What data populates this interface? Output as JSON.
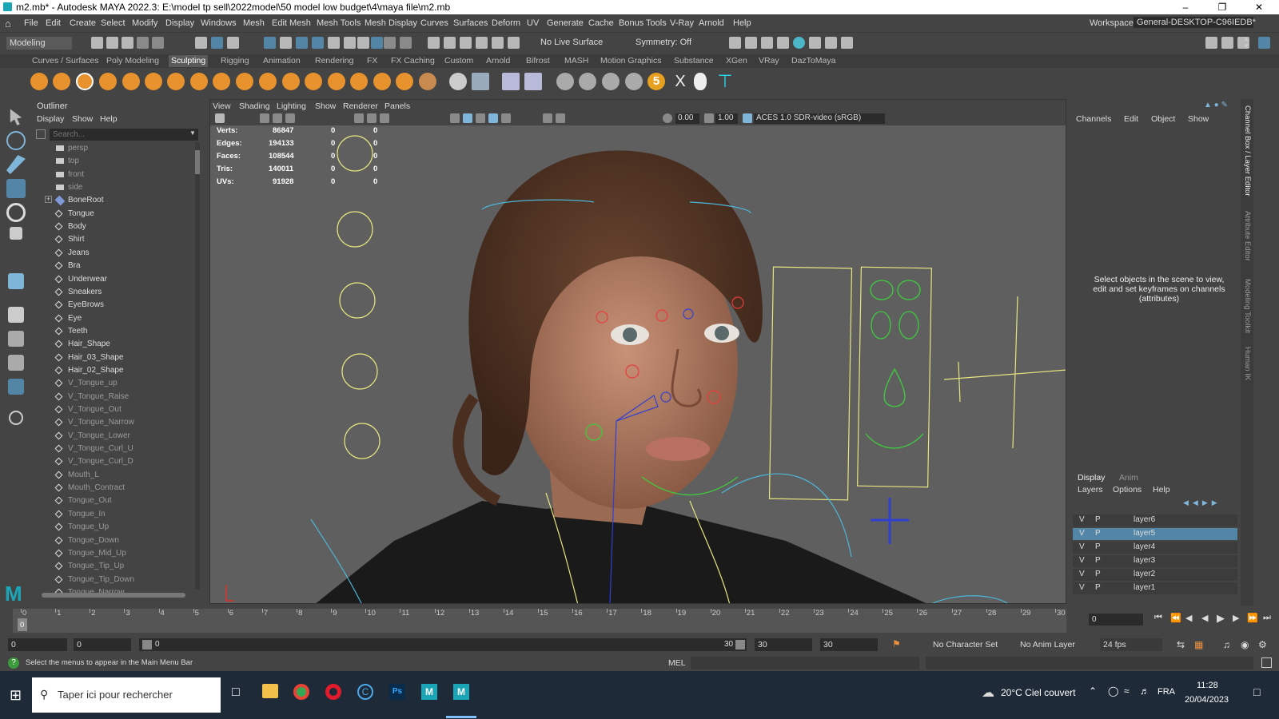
{
  "window": {
    "title": "m2.mb* - Autodesk MAYA 2022.3: E:\\model tp sell\\2022model\\50 model low budget\\4\\maya file\\m2.mb"
  },
  "menubar": {
    "items": [
      "File",
      "Edit",
      "Create",
      "Select",
      "Modify",
      "Display",
      "Windows",
      "Mesh",
      "Edit Mesh",
      "Mesh Tools",
      "Mesh Display",
      "Curves",
      "Surfaces",
      "Deform",
      "UV",
      "Generate",
      "Cache",
      "Bonus Tools",
      "V-Ray",
      "Arnold",
      "Help"
    ],
    "workspace_label": "Workspace:",
    "workspace_value": "General-DESKTOP-C96IEDB*"
  },
  "statusline": {
    "mode": "Modeling",
    "live_surface": "No Live Surface",
    "symmetry": "Symmetry: Off"
  },
  "shelf": {
    "tabs": [
      "Curves / Surfaces",
      "Poly Modeling",
      "Sculpting",
      "Rigging",
      "Animation",
      "Rendering",
      "FX",
      "FX Caching",
      "Custom",
      "Arnold",
      "Bifrost",
      "MASH",
      "Motion Graphics",
      "Substance",
      "XGen",
      "VRay",
      "DazToMaya"
    ],
    "active": "Sculpting",
    "badge": "5"
  },
  "outliner": {
    "title": "Outliner",
    "menus": [
      "Display",
      "Show",
      "Help"
    ],
    "search_placeholder": "Search...",
    "items": [
      {
        "label": "persp",
        "dim": true
      },
      {
        "label": "top",
        "dim": true
      },
      {
        "label": "front",
        "dim": true
      },
      {
        "label": "side",
        "dim": true
      },
      {
        "label": "BoneRoot"
      },
      {
        "label": "Tongue"
      },
      {
        "label": "Body"
      },
      {
        "label": "Shirt"
      },
      {
        "label": "Jeans"
      },
      {
        "label": "Bra"
      },
      {
        "label": "Underwear"
      },
      {
        "label": "Sneakers"
      },
      {
        "label": "EyeBrows"
      },
      {
        "label": "Eye"
      },
      {
        "label": "Teeth"
      },
      {
        "label": "Hair_Shape"
      },
      {
        "label": "Hair_03_Shape"
      },
      {
        "label": "Hair_02_Shape"
      },
      {
        "label": "V_Tongue_up",
        "dim": true
      },
      {
        "label": "V_Tongue_Raise",
        "dim": true
      },
      {
        "label": "V_Tongue_Out",
        "dim": true
      },
      {
        "label": "V_Tongue_Narrow",
        "dim": true
      },
      {
        "label": "V_Tongue_Lower",
        "dim": true
      },
      {
        "label": "V_Tongue_Curl_U",
        "dim": true
      },
      {
        "label": "V_Tongue_Curl_D",
        "dim": true
      },
      {
        "label": "Mouth_L",
        "dim": true
      },
      {
        "label": "Mouth_Contract",
        "dim": true
      },
      {
        "label": "Tongue_Out",
        "dim": true
      },
      {
        "label": "Tongue_In",
        "dim": true
      },
      {
        "label": "Tongue_Up",
        "dim": true
      },
      {
        "label": "Tongue_Down",
        "dim": true
      },
      {
        "label": "Tongue_Mid_Up",
        "dim": true
      },
      {
        "label": "Tongue_Tip_Up",
        "dim": true
      },
      {
        "label": "Tongue_Tip_Down",
        "dim": true
      },
      {
        "label": "Tongue_Narrow",
        "dim": true
      }
    ]
  },
  "viewport": {
    "menus": [
      "View",
      "Shading",
      "Lighting",
      "Show",
      "Renderer",
      "Panels"
    ],
    "exposure": "0.00",
    "gamma": "1.00",
    "colorspace": "ACES 1.0 SDR-video (sRGB)",
    "hud": [
      {
        "label": "Verts:",
        "value": "86847",
        "a": "0",
        "b": "0"
      },
      {
        "label": "Edges:",
        "value": "194133",
        "a": "0",
        "b": "0"
      },
      {
        "label": "Faces:",
        "value": "108544",
        "a": "0",
        "b": "0"
      },
      {
        "label": "Tris:",
        "value": "140011",
        "a": "0",
        "b": "0"
      },
      {
        "label": "UVs:",
        "value": "91928",
        "a": "0",
        "b": "0"
      }
    ]
  },
  "channelbox": {
    "menus": [
      "Channels",
      "Edit",
      "Object",
      "Show"
    ],
    "message": "Select objects in the scene to view, edit and set keyframes on channels (attributes)",
    "side_tabs": [
      "Channel Box / Layer Editor",
      "Attribute Editor",
      "Modeling Toolkit",
      "Human IK"
    ]
  },
  "layers": {
    "tabs": [
      "Display",
      "Anim"
    ],
    "menus": [
      "Layers",
      "Options",
      "Help"
    ],
    "rows": [
      {
        "v": "V",
        "p": "P",
        "name": "layer6"
      },
      {
        "v": "V",
        "p": "P",
        "name": "layer5",
        "selected": true
      },
      {
        "v": "V",
        "p": "P",
        "name": "layer4"
      },
      {
        "v": "V",
        "p": "P",
        "name": "layer3"
      },
      {
        "v": "V",
        "p": "P",
        "name": "layer2"
      },
      {
        "v": "V",
        "p": "P",
        "name": "layer1"
      }
    ]
  },
  "timeline": {
    "start": 0,
    "end": 30,
    "current_frame": "0",
    "ticks": [
      "0",
      "1",
      "2",
      "3",
      "4",
      "5",
      "6",
      "7",
      "8",
      "9",
      "10",
      "11",
      "12",
      "13",
      "14",
      "15",
      "16",
      "17",
      "18",
      "19",
      "20",
      "21",
      "22",
      "23",
      "24",
      "25",
      "26",
      "27",
      "28",
      "29",
      "30"
    ]
  },
  "range": {
    "start": "0",
    "anim_start": "0",
    "slider_start": "0",
    "slider_end": "30",
    "anim_end": "30",
    "end": "30",
    "character_set": "No Character Set",
    "anim_layer": "No Anim Layer",
    "fps": "24 fps"
  },
  "cmdline": {
    "help": "Select the menus to appear in the Main Menu Bar",
    "lang": "MEL"
  },
  "taskbar": {
    "search": "Taper ici pour rechercher",
    "weather": "20°C  Ciel couvert",
    "lang": "FRA",
    "time": "11:28",
    "date": "20/04/2023"
  }
}
